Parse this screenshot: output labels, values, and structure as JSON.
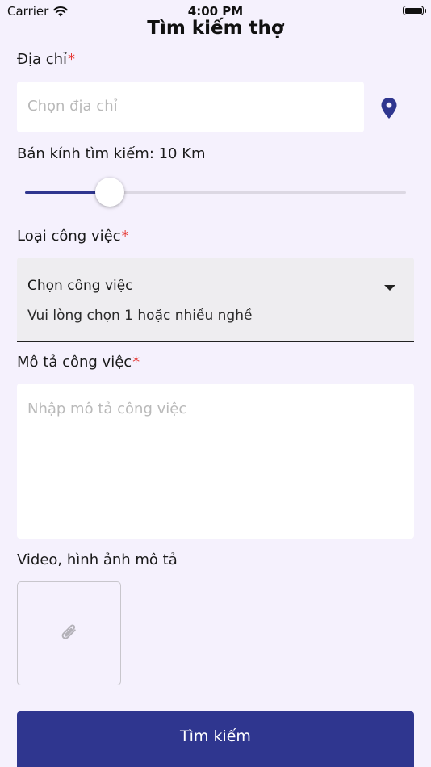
{
  "status_bar": {
    "carrier": "Carrier",
    "time": "4:00 PM"
  },
  "header": {
    "title": "Tìm kiếm thợ"
  },
  "address": {
    "label": "Địa chỉ",
    "required_mark": "*",
    "placeholder": "Chọn địa chỉ",
    "icon": "location-pin-icon"
  },
  "radius": {
    "label": "Bán kính tìm kiếm: 10 Km",
    "value_km": 10
  },
  "job_type": {
    "label": "Loại công việc",
    "required_mark": "*",
    "selected": "Chọn công việc",
    "helper": "Vui lòng chọn 1 hoặc nhiều nghề"
  },
  "description": {
    "label": "Mô tả công việc",
    "required_mark": "*",
    "placeholder": "Nhập mô tả công việc"
  },
  "media": {
    "label": "Video, hình ảnh mô tả",
    "icon": "paperclip-icon"
  },
  "submit": {
    "label": "Tìm kiếm"
  },
  "colors": {
    "background": "#f5f1fd",
    "accent": "#2f368f",
    "required": "#e53935"
  }
}
